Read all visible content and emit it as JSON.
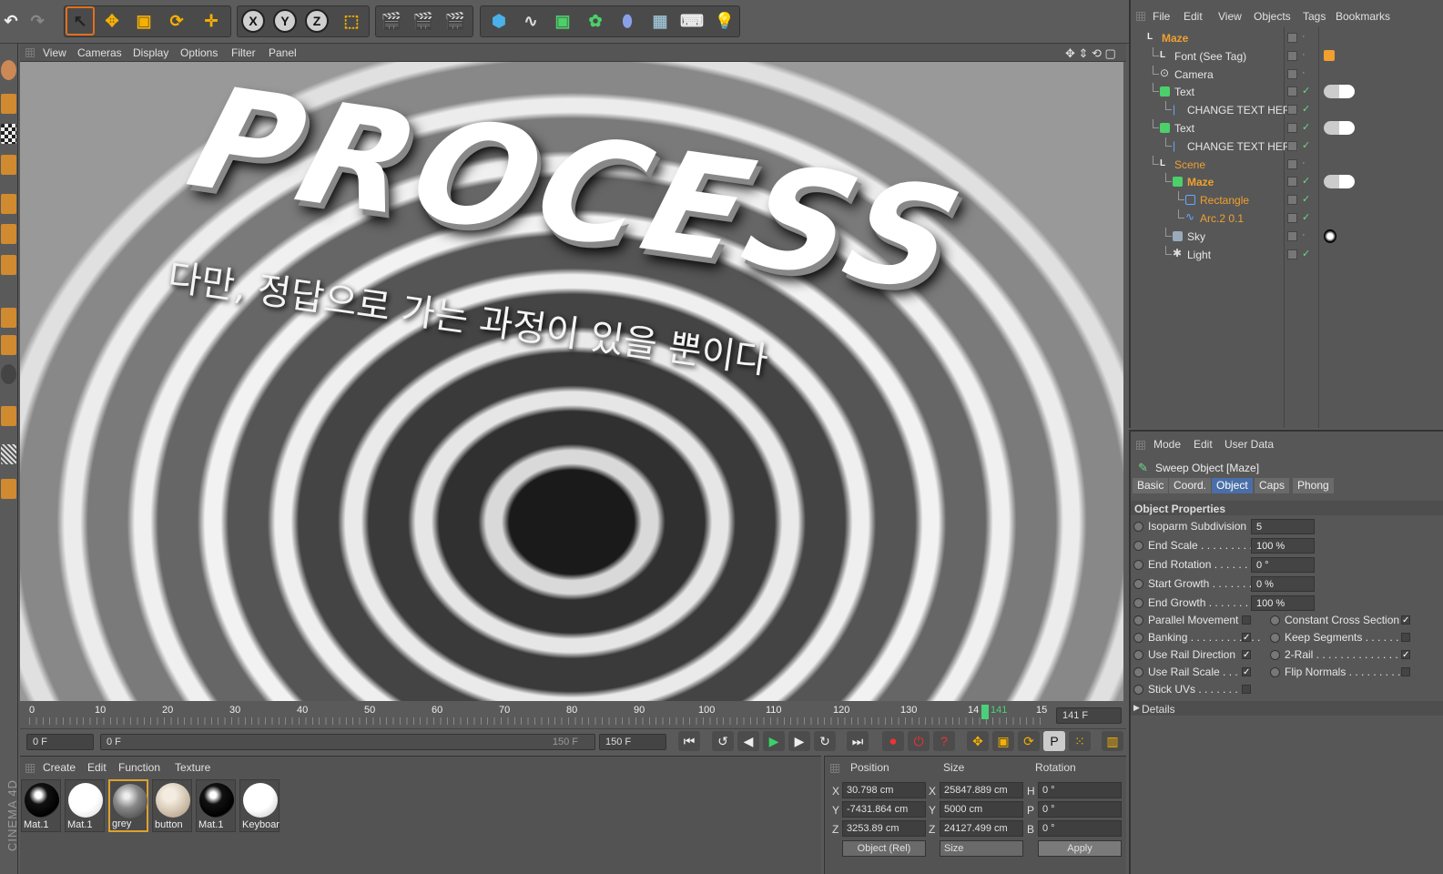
{
  "viewport_menu": [
    "View",
    "Cameras",
    "Display",
    "Options",
    "Filter",
    "Panel"
  ],
  "viewport_scene": {
    "title": "PROCESS",
    "subtitle": "다만, 정답으로 가는 과정이 있을 뿐이다"
  },
  "axis_buttons": [
    "X",
    "Y",
    "Z"
  ],
  "timeline": {
    "ticks": [
      "0",
      "10",
      "20",
      "30",
      "40",
      "50",
      "60",
      "70",
      "80",
      "90",
      "100",
      "110",
      "120",
      "130",
      "14",
      "141",
      "15"
    ],
    "current_frame_field": "141 F",
    "playhead_frame": 141
  },
  "transport": {
    "start_field": "0 F",
    "range_start": "0 F",
    "range_end": "150 F",
    "end_field": "150 F"
  },
  "material_menu": [
    "Create",
    "Edit",
    "Function",
    "Texture"
  ],
  "materials": [
    {
      "label": "Mat.1",
      "type": "black"
    },
    {
      "label": "Mat.1",
      "type": "white"
    },
    {
      "label": "grey",
      "type": "grey"
    },
    {
      "label": "button",
      "type": "beige"
    },
    {
      "label": "Mat.1",
      "type": "black"
    },
    {
      "label": "Keyboar",
      "type": "white"
    }
  ],
  "branding": "CINEMA 4D",
  "coords": {
    "headers": [
      "Position",
      "Size",
      "Rotation"
    ],
    "rows": [
      {
        "axis": "X",
        "pos": "30.798 cm",
        "saxis": "X",
        "size": "25847.889 cm",
        "raxis": "H",
        "rot": "0 °"
      },
      {
        "axis": "Y",
        "pos": "-7431.864 cm",
        "saxis": "Y",
        "size": "5000 cm",
        "raxis": "P",
        "rot": "0 °"
      },
      {
        "axis": "Z",
        "pos": "3253.89 cm",
        "saxis": "Z",
        "size": "24127.499 cm",
        "raxis": "B",
        "rot": "0 °"
      }
    ],
    "mode_select": "Object (Rel)",
    "size_select": "Size",
    "apply": "Apply"
  },
  "object_menu": [
    "File",
    "Edit",
    "View",
    "Objects",
    "Tags",
    "Bookmarks"
  ],
  "objects": [
    {
      "name": "Maze",
      "indent": 0,
      "color": "#f0a030"
    },
    {
      "name": "Font (See Tag)",
      "indent": 1,
      "color": "#e6e6e6"
    },
    {
      "name": "Camera",
      "indent": 1,
      "color": "#e6e6e6"
    },
    {
      "name": "Text",
      "indent": 1,
      "color": "#e6e6e6"
    },
    {
      "name": "CHANGE TEXT HERE",
      "indent": 2,
      "color": "#e6e6e6"
    },
    {
      "name": "Text",
      "indent": 1,
      "color": "#e6e6e6"
    },
    {
      "name": "CHANGE TEXT HERE",
      "indent": 2,
      "color": "#e6e6e6"
    },
    {
      "name": "Scene",
      "indent": 1,
      "color": "#f0a030"
    },
    {
      "name": "Maze",
      "indent": 2,
      "color": "#f0a030"
    },
    {
      "name": "Rectangle",
      "indent": 3,
      "color": "#f0a030"
    },
    {
      "name": "Arc.2 0.1",
      "indent": 3,
      "color": "#f0a030"
    },
    {
      "name": "Sky",
      "indent": 2,
      "color": "#e6e6e6"
    },
    {
      "name": "Light",
      "indent": 2,
      "color": "#e6e6e6"
    }
  ],
  "attr_menu": [
    "Mode",
    "Edit",
    "User Data"
  ],
  "attr_title": "Sweep Object [Maze]",
  "attr_tabs": [
    "Basic",
    "Coord.",
    "Object",
    "Caps",
    "Phong"
  ],
  "active_tab": "Object",
  "section_title": "Object Properties",
  "props_values": [
    {
      "label": "Isoparm Subdivision",
      "value": "5"
    },
    {
      "label": "End Scale . . . . . . . . . .",
      "value": "100 %"
    },
    {
      "label": "End Rotation . . . . . . .",
      "value": "0 °"
    },
    {
      "label": "Start Growth . . . . . . .",
      "value": "0 %"
    },
    {
      "label": "End Growth . . . . . . . .",
      "value": "100 %"
    }
  ],
  "props_left": [
    {
      "label": "Parallel Movement",
      "checked": false
    },
    {
      "label": "Banking . . . . . . . . . . . .",
      "checked": true
    },
    {
      "label": "Use Rail Direction",
      "checked": true
    },
    {
      "label": "Use Rail Scale . . . .",
      "checked": true
    },
    {
      "label": "Stick UVs . . . . . . . . .",
      "checked": false
    }
  ],
  "props_right": [
    {
      "label": "Constant Cross Section",
      "checked": true
    },
    {
      "label": "Keep Segments . . . . . .",
      "checked": false
    },
    {
      "label": "2-Rail . . . . . . . . . . . . . . . .",
      "checked": true
    },
    {
      "label": "Flip Normals . . . . . . . . .",
      "checked": false
    }
  ],
  "details": "Details"
}
